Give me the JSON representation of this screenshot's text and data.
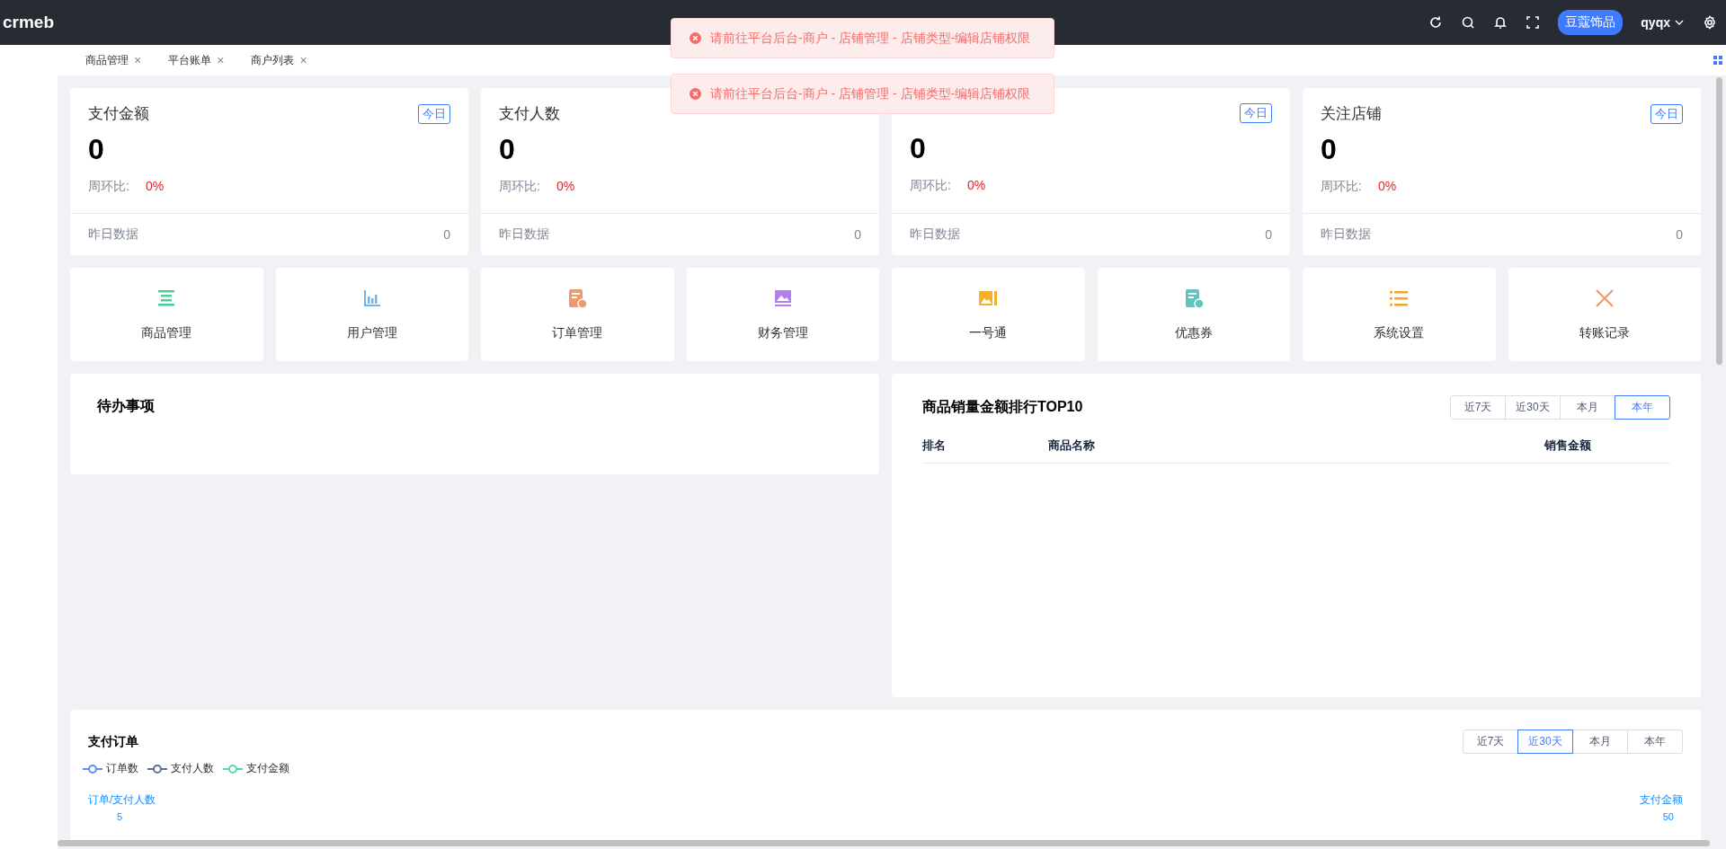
{
  "header": {
    "logo": "crmeb",
    "store_button": "豆蔻饰品",
    "user": "qyqx"
  },
  "tabs": [
    {
      "label": "商品管理",
      "close": "×"
    },
    {
      "label": "平台账单",
      "close": "×"
    },
    {
      "label": "商户列表",
      "close": "×"
    }
  ],
  "stats": [
    {
      "title": "支付金额",
      "badge": "今日",
      "value": "0",
      "ratio_label": "周环比:",
      "ratio": "0%",
      "yesterday_label": "昨日数据",
      "yesterday": "0"
    },
    {
      "title": "支付人数",
      "value": "0",
      "ratio_label": "周环比:",
      "ratio": "0%",
      "yesterday_label": "昨日数据",
      "yesterday": "0"
    },
    {
      "badge": "今日",
      "value": "0",
      "ratio_label": "周环比:",
      "ratio": "0%",
      "yesterday_label": "昨日数据",
      "yesterday": "0"
    },
    {
      "title": "关注店铺",
      "badge": "今日",
      "value": "0",
      "ratio_label": "周环比:",
      "ratio": "0%",
      "yesterday_label": "昨日数据",
      "yesterday": "0"
    }
  ],
  "shortcuts": [
    {
      "label": "商品管理",
      "color": "#4ccf96"
    },
    {
      "label": "用户管理",
      "color": "#69b7f7"
    },
    {
      "label": "订单管理",
      "color": "#ef9a6a"
    },
    {
      "label": "财务管理",
      "color": "#b37feb"
    },
    {
      "label": "一号通",
      "color": "#f5b12c"
    },
    {
      "label": "优惠券",
      "color": "#5cc6bf"
    },
    {
      "label": "系统设置",
      "color": "#f5a623"
    },
    {
      "label": "转账记录",
      "color": "#f09a6f"
    }
  ],
  "todo": {
    "title": "待办事项"
  },
  "ranking": {
    "title": "商品销量金额排行TOP10",
    "periods": [
      {
        "label": "近7天",
        "selected": false
      },
      {
        "label": "近30天",
        "selected": false
      },
      {
        "label": "本月",
        "selected": false
      },
      {
        "label": "本年",
        "selected": true
      }
    ],
    "columns": [
      "排名",
      "商品名称",
      "销售金额"
    ]
  },
  "orders": {
    "title": "支付订单",
    "periods": [
      {
        "label": "近7天",
        "selected": false
      },
      {
        "label": "近30天",
        "selected": true
      },
      {
        "label": "本月",
        "selected": false
      },
      {
        "label": "本年",
        "selected": false
      }
    ],
    "legend": [
      {
        "label": "订单数",
        "color": "#5b8ff9"
      },
      {
        "label": "支付人数",
        "color": "#5d7092"
      },
      {
        "label": "支付金额",
        "color": "#5ad8a6"
      }
    ],
    "left_axis": "订单/支付人数",
    "right_axis": "支付金额",
    "left_tick": "5",
    "right_tick": "50"
  },
  "toasts": [
    {
      "message": "请前往平台后台-商户 - 店铺管理 - 店铺类型-编辑店铺权限"
    },
    {
      "message": "请前往平台后台-商户 - 店铺管理 - 店铺类型-编辑店铺权限"
    }
  ]
}
